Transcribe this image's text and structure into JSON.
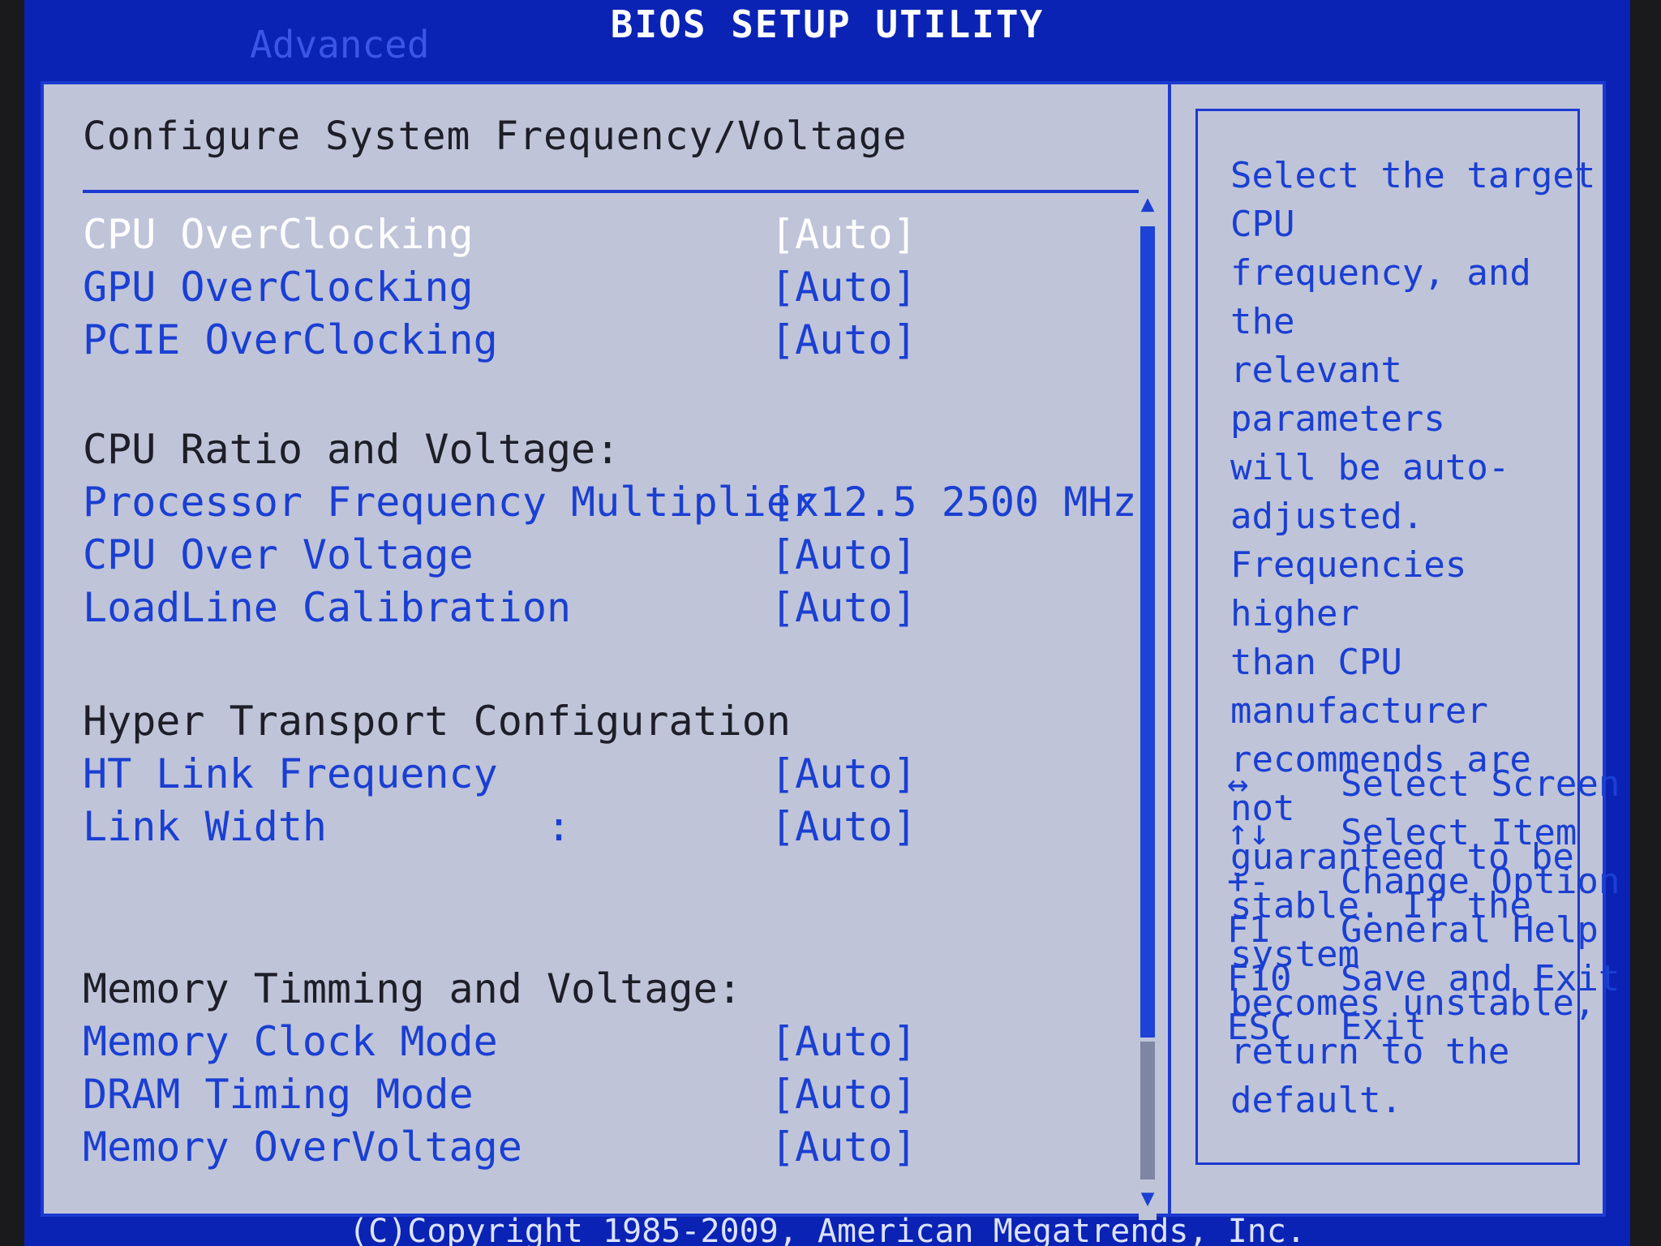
{
  "window": {
    "title": "BIOS SETUP UTILITY",
    "active_tab": "Advanced"
  },
  "main": {
    "heading": "Configure System Frequency/Voltage",
    "items": [
      {
        "label": "CPU OverClocking",
        "value": "[Auto]",
        "selected": true
      },
      {
        "label": "GPU OverClocking",
        "value": "[Auto]"
      },
      {
        "label": "PCIE OverClocking",
        "value": "[Auto]"
      }
    ],
    "section_cpu": "CPU Ratio and Voltage:",
    "cpu_items": [
      {
        "label": "Processor Frequency Multiplier",
        "value": "[x12.5 2500 MHz]"
      },
      {
        "label": "CPU Over Voltage",
        "value": "[Auto]"
      },
      {
        "label": "LoadLine Calibration",
        "value": "[Auto]"
      }
    ],
    "section_ht": "Hyper Transport Configuration",
    "ht_items": [
      {
        "label": "HT Link Frequency",
        "value": "[Auto]"
      },
      {
        "label": "Link Width         :",
        "value": "[Auto]"
      }
    ],
    "section_mem": "Memory Timming and Voltage:",
    "mem_items": [
      {
        "label": "Memory Clock Mode",
        "value": "[Auto]"
      },
      {
        "label": "DRAM Timing Mode",
        "value": "[Auto]"
      },
      {
        "label": "Memory OverVoltage",
        "value": "[Auto]"
      }
    ]
  },
  "help": {
    "text": "Select the target CPU\nfrequency, and the\nrelevant parameters\nwill be auto-adjusted.\nFrequencies higher\nthan CPU manufacturer\nrecommends are not\nguaranteed to be\nstable. If the system\nbecomes unstable,\nreturn to the default.",
    "keys": [
      {
        "key": "↔",
        "desc": "Select Screen"
      },
      {
        "key": "↑↓",
        "desc": "Select Item"
      },
      {
        "key": "+-",
        "desc": "Change Option"
      },
      {
        "key": "F1",
        "desc": "General Help"
      },
      {
        "key": "F10",
        "desc": "Save and Exit"
      },
      {
        "key": "ESC",
        "desc": "Exit"
      }
    ]
  },
  "footer": {
    "copyright": "(C)Copyright 1985-2009, American Megatrends, Inc."
  },
  "icons": {
    "scroll_up": "triangle-up",
    "scroll_down": "triangle-down"
  },
  "colors": {
    "frame_blue": "#0a23b4",
    "panel_grey": "#bfc4d9",
    "item_blue": "#1a3fd2",
    "selected_white": "#ffffff"
  }
}
